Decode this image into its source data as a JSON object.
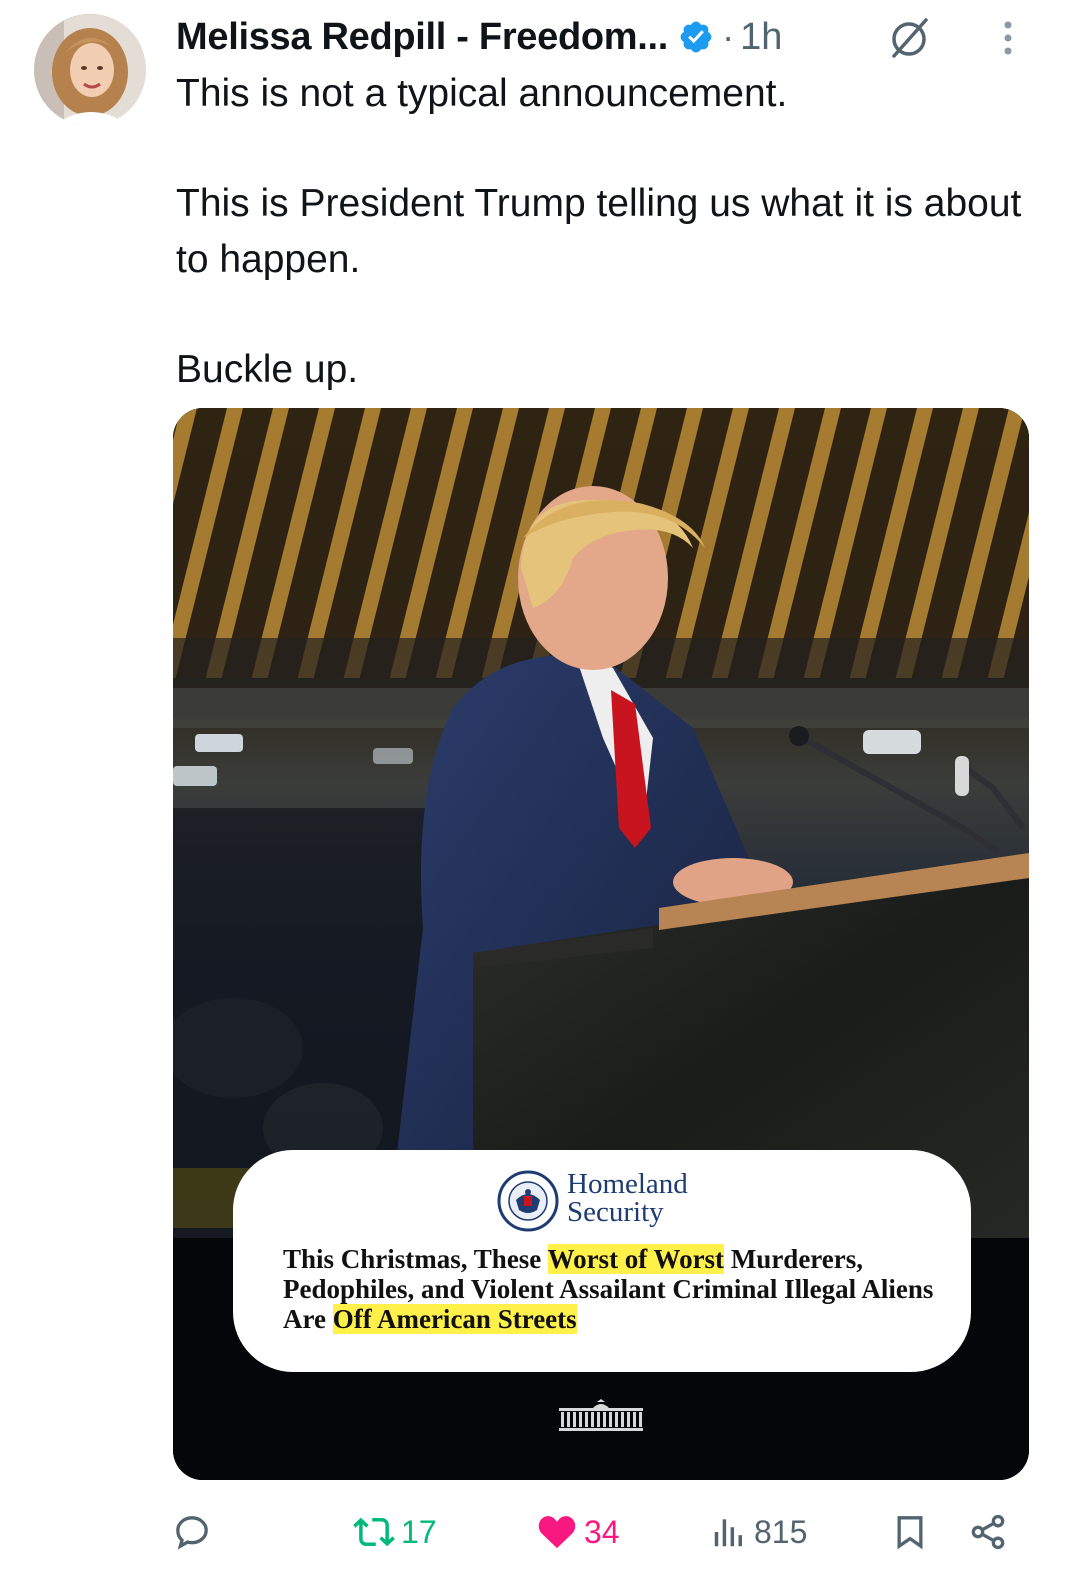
{
  "post": {
    "author_name": "Melissa Redpill - Freedom...",
    "separator": "·",
    "time": "1h",
    "paragraphs": [
      "This is not a typical announcement.",
      "This is President Trump telling us what it is about to happen.",
      "Buckle up."
    ]
  },
  "media": {
    "agency_line1": "Homeland",
    "agency_line2": "Security",
    "caption": {
      "p1": "This Christmas, These ",
      "h1": "Worst of Worst",
      "p2": " Murderers, Pedophiles, and Violent Assailant Criminal Illegal Aliens Are ",
      "h2": "Off American Streets"
    }
  },
  "actions": {
    "reposts": "17",
    "likes": "34",
    "views": "815"
  },
  "icons": {
    "verified": "verified-badge-icon",
    "grok": "grok-icon",
    "more": "more-vertical-icon",
    "reply": "reply-icon",
    "repost": "repost-icon",
    "like": "heart-icon",
    "views": "views-chart-icon",
    "bookmark": "bookmark-icon",
    "share": "share-icon"
  },
  "colors": {
    "verified": "#1d9bf0",
    "repost_active": "#00ba7c",
    "like_active": "#f91880",
    "muted": "#536471",
    "highlight": "#fff04a"
  }
}
